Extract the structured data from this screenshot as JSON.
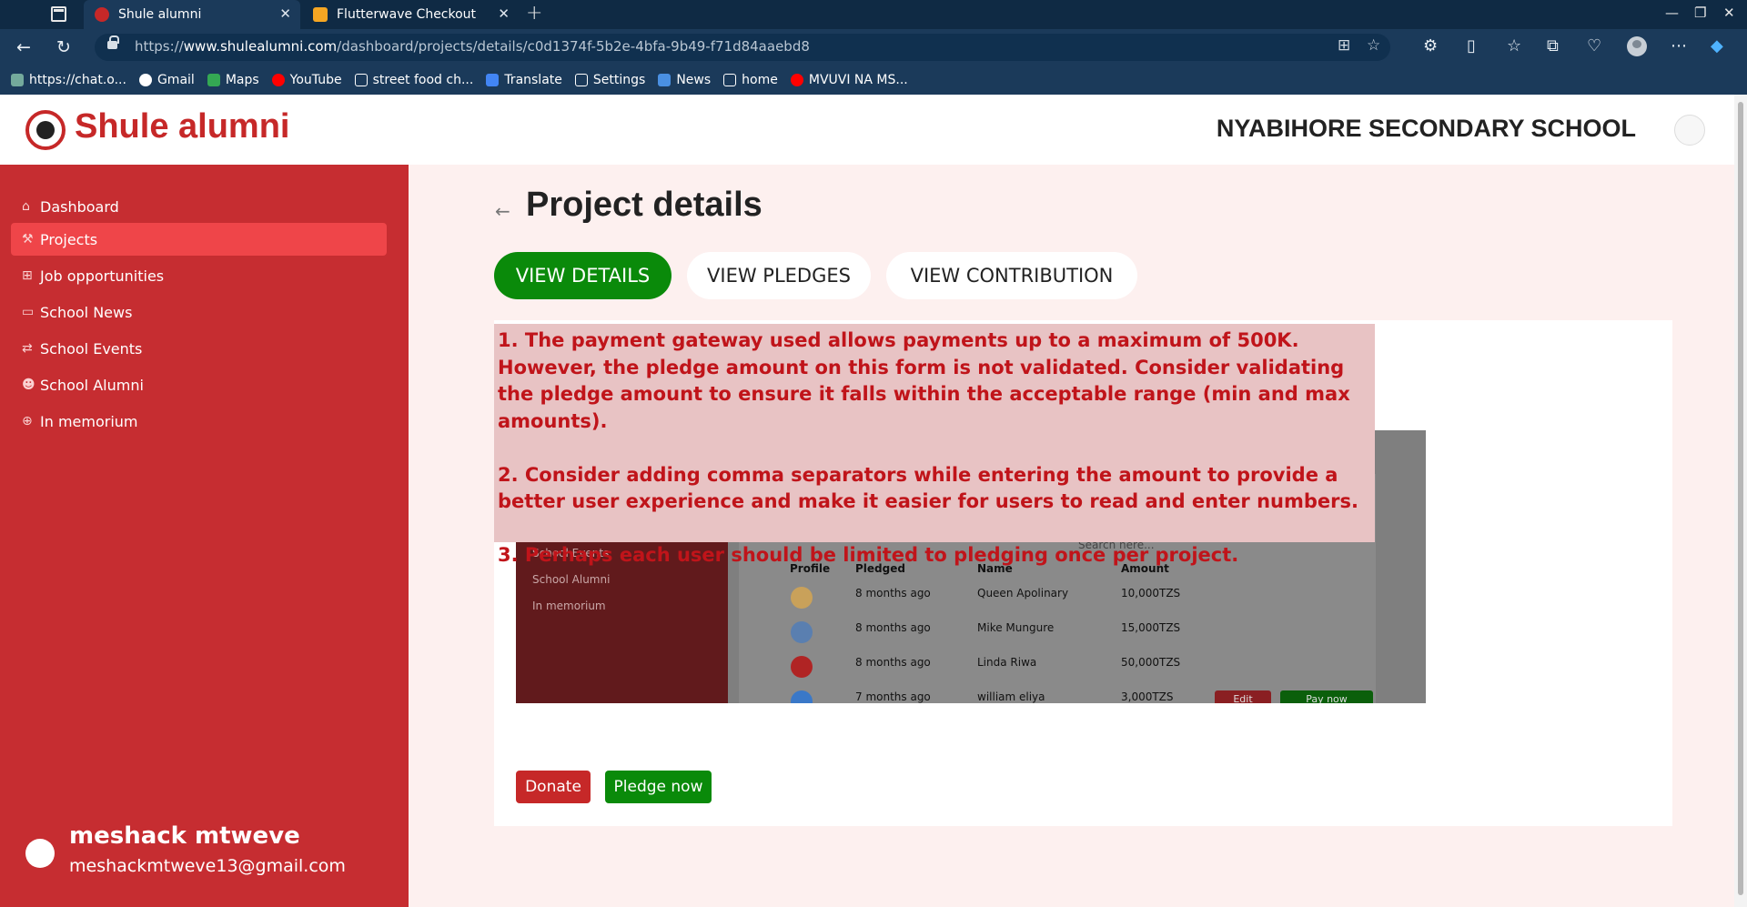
{
  "browser": {
    "tabs": [
      {
        "title": "Shule alumni",
        "active": true
      },
      {
        "title": "Flutterwave Checkout",
        "active": false
      }
    ],
    "url_prefix": "https://",
    "url_domain": "www.shulealumni.com",
    "url_path": "/dashboard/projects/details/c0d1374f-5b2e-4bfa-9b49-f71d84aaebd8",
    "bookmarks": [
      "https://chat.o...",
      "Gmail",
      "Maps",
      "YouTube",
      "street food ch...",
      "Translate",
      "Settings",
      "News",
      "home",
      "MVUVI NA MS..."
    ]
  },
  "header": {
    "brand": "Shule alumni",
    "school": "NYABIHORE SECONDARY SCHOOL"
  },
  "sidebar": {
    "items": [
      {
        "label": "Dashboard",
        "icon": "home-icon"
      },
      {
        "label": "Projects",
        "icon": "hammer-icon",
        "active": true
      },
      {
        "label": "Job opportunities",
        "icon": "sitemap-icon"
      },
      {
        "label": "School News",
        "icon": "monitor-icon"
      },
      {
        "label": "School Events",
        "icon": "events-icon"
      },
      {
        "label": "School Alumni",
        "icon": "users-icon"
      },
      {
        "label": "In memorium",
        "icon": "plus-circle-icon"
      }
    ],
    "user": {
      "name": "meshack mtweve",
      "email": "meshackmtweve13@gmail.com"
    }
  },
  "main": {
    "title": "Project details",
    "tabs": [
      {
        "label": "VIEW DETAILS",
        "active": true
      },
      {
        "label": "VIEW PLEDGES"
      },
      {
        "label": "VIEW CONTRIBUTION"
      }
    ],
    "notes": [
      "1. The payment gateway used allows payments up to a maximum of 500K. However, the pledge amount on this form is not validated. Consider validating the pledge amount to ensure it falls within the acceptable range (min and max amounts).",
      "2. Consider adding comma separators while entering the amount to provide a better user experience and make it easier for users to read and enter  numbers.",
      "3. Perhaps each user should be limited to pledging once per project."
    ],
    "screenshot": {
      "sidebar_items": [
        "School Events",
        "School Alumni",
        "In memorium"
      ],
      "search_placeholder": "Search here...",
      "columns": [
        "Profile",
        "Pledged",
        "Name",
        "Amount"
      ],
      "rows": [
        {
          "pledged": "8 months ago",
          "name": "Queen Apolinary",
          "amount": "10,000TZS"
        },
        {
          "pledged": "8 months ago",
          "name": "Mike Mungure",
          "amount": "15,000TZS"
        },
        {
          "pledged": "8 months ago",
          "name": "Linda Riwa",
          "amount": "50,000TZS"
        },
        {
          "pledged": "7 months ago",
          "name": "william eliya",
          "amount": "3,000TZS"
        }
      ],
      "edit_label": "Edit",
      "pay_label": "Pay now"
    },
    "buttons": {
      "donate": "Donate",
      "pledge": "Pledge now"
    }
  },
  "colors": {
    "brand_red": "#c62828",
    "sidebar_red": "#c62d31",
    "active_item": "#ef4549",
    "green": "#0a8a0a"
  }
}
